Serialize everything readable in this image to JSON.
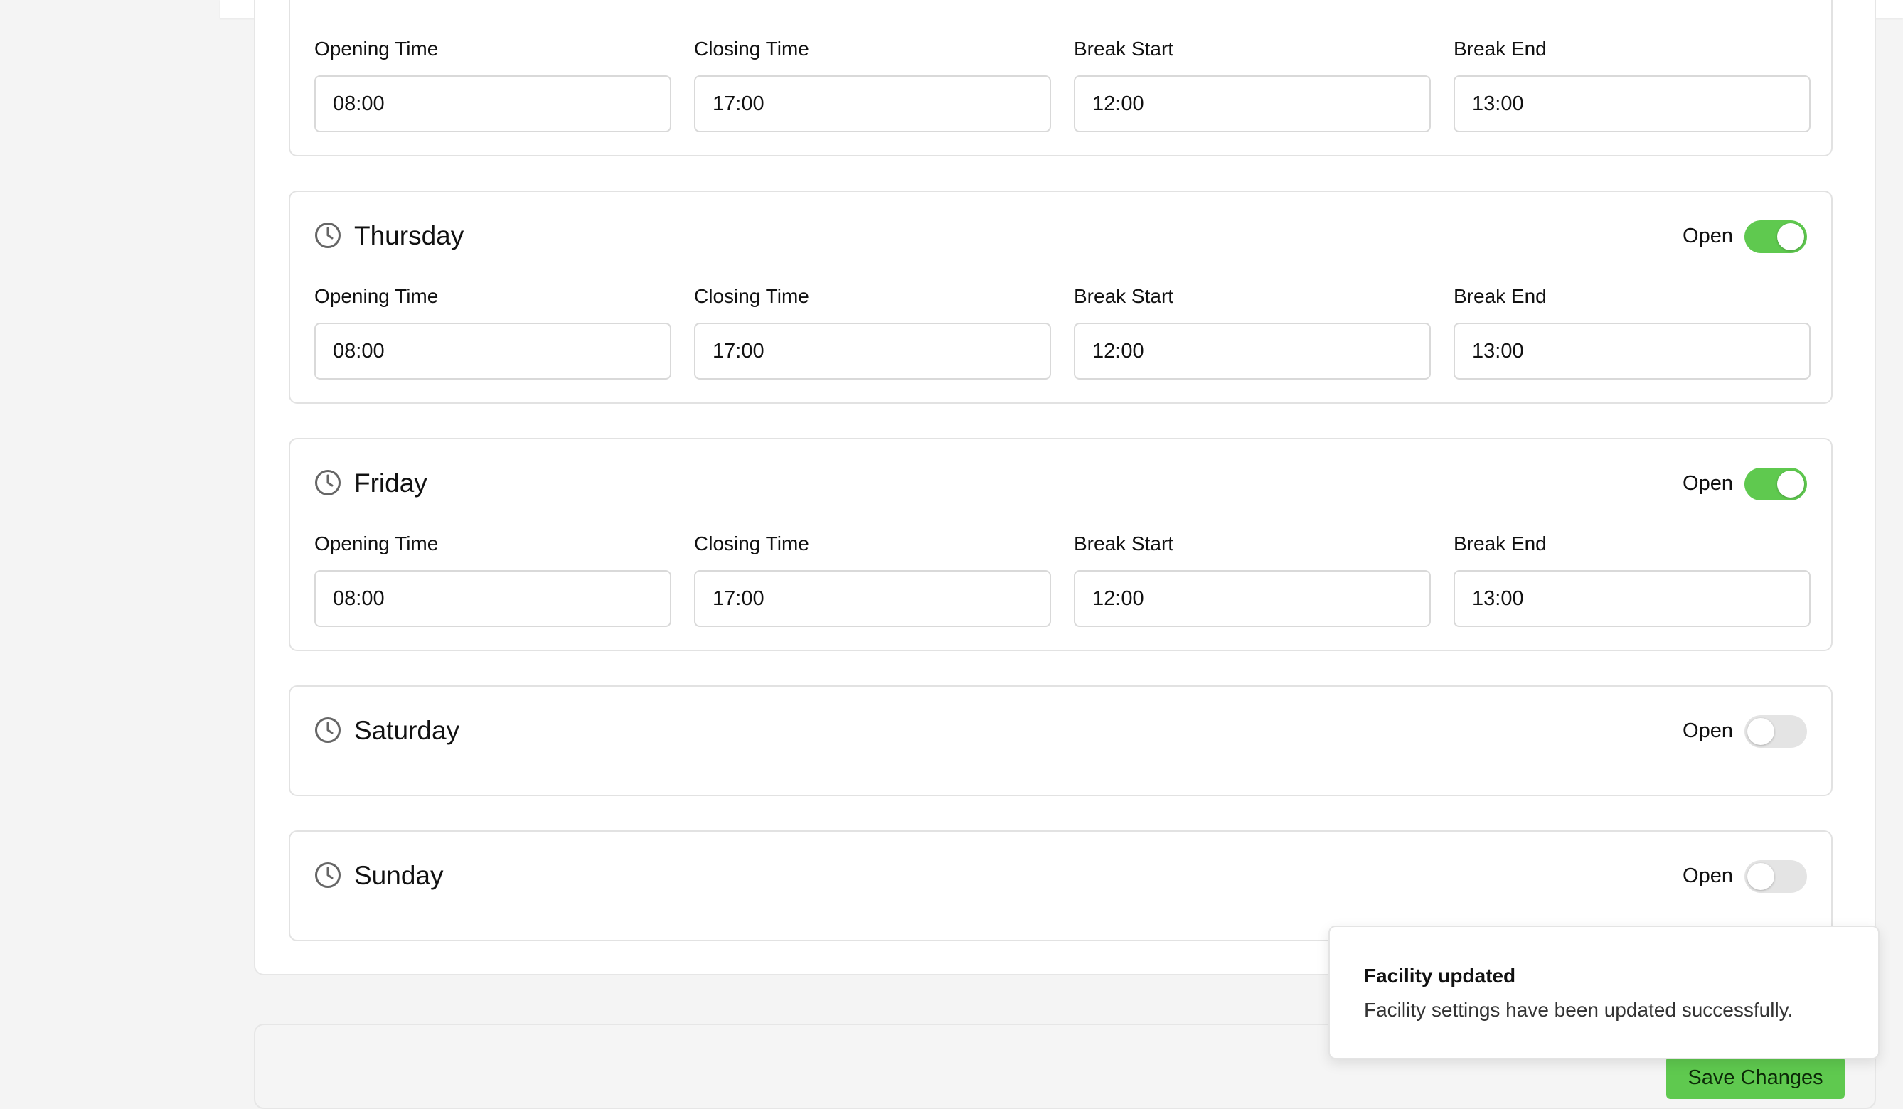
{
  "labels": {
    "open": "Open",
    "opening_time": "Opening Time",
    "closing_time": "Closing Time",
    "break_start": "Break Start",
    "break_end": "Break End"
  },
  "wednesday": {
    "opening": "08:00",
    "closing": "17:00",
    "break_start": "12:00",
    "break_end": "13:00"
  },
  "thursday": {
    "name": "Thursday",
    "open": true,
    "opening": "08:00",
    "closing": "17:00",
    "break_start": "12:00",
    "break_end": "13:00"
  },
  "friday": {
    "name": "Friday",
    "open": true,
    "opening": "08:00",
    "closing": "17:00",
    "break_start": "12:00",
    "break_end": "13:00"
  },
  "saturday": {
    "name": "Saturday",
    "open": false
  },
  "sunday": {
    "name": "Sunday",
    "open": false
  },
  "toast": {
    "title": "Facility updated",
    "description": "Facility settings have been updated successfully."
  },
  "footer": {
    "save_label": "Save Changes"
  },
  "colors": {
    "toggle_on": "#5fc94f",
    "toggle_off": "#e4e4e4",
    "save_button": "#5fc94f"
  }
}
